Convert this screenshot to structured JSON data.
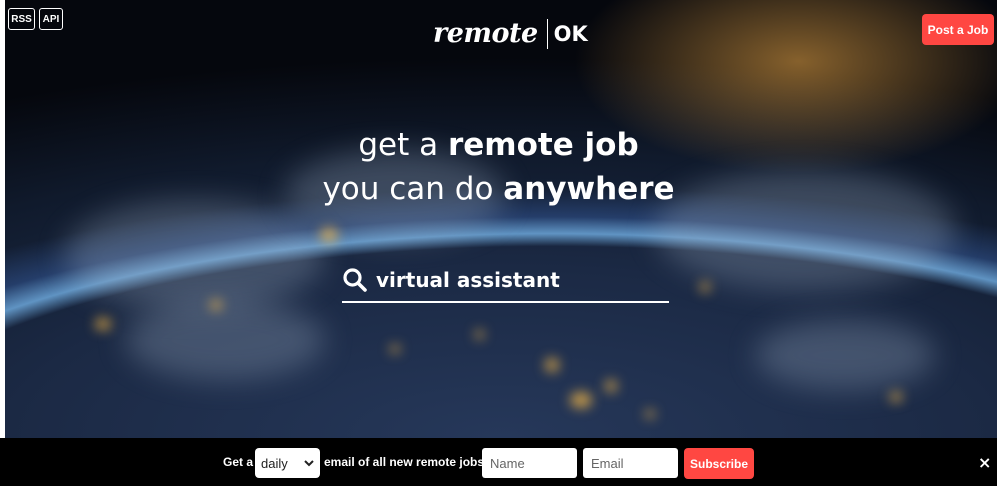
{
  "header": {
    "rss_label": "RSS",
    "api_label": "API",
    "logo_script": "remote",
    "logo_ok": "OK",
    "post_job_label": "Post a Job"
  },
  "hero": {
    "line1_light": "get a ",
    "line1_bold": "remote job",
    "line2_light": "you can do ",
    "line2_bold": "anywhere"
  },
  "search": {
    "value": "virtual assistant",
    "icon": "search-icon"
  },
  "subscribe_bar": {
    "prefix": "Get a",
    "frequency_selected": "daily",
    "suffix": "email of all new remote jobs",
    "name_placeholder": "Name",
    "email_placeholder": "Email",
    "subscribe_label": "Subscribe",
    "close_label": "×"
  },
  "colors": {
    "accent": "#ff4742",
    "bar_background": "#000000",
    "text": "#ffffff"
  }
}
